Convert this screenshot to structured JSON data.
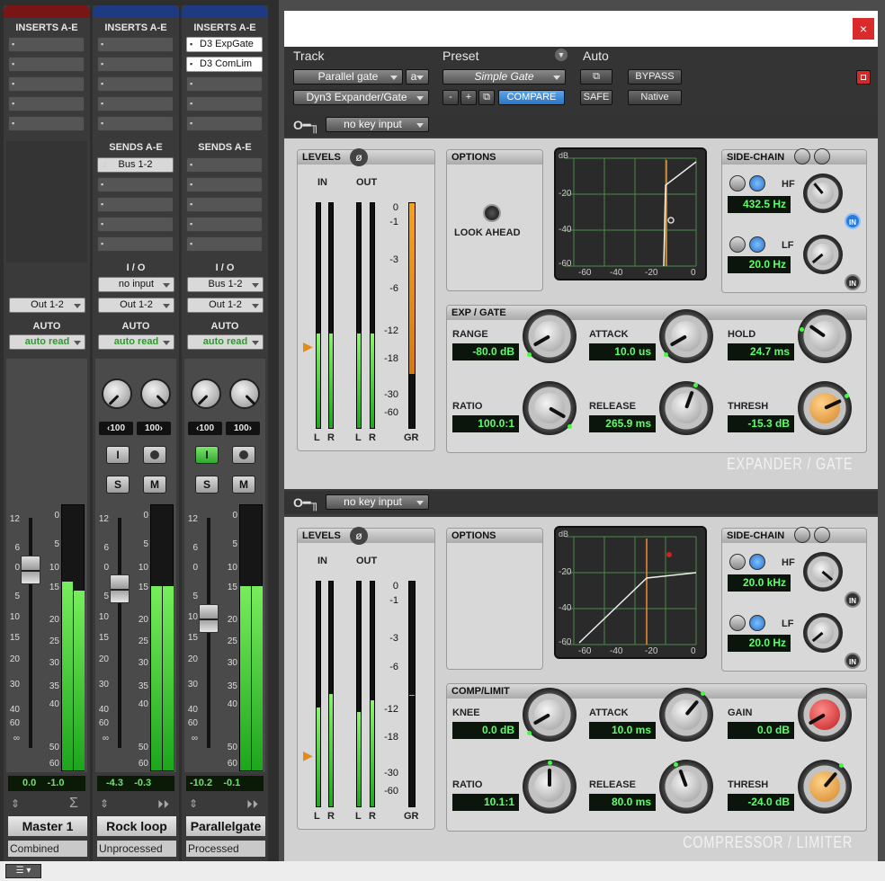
{
  "mixer": {
    "inserts_header": "INSERTS A-E",
    "sends_header": "SENDS A-E",
    "io_header": "I / O",
    "auto_header": "AUTO",
    "strips": [
      {
        "name": "Master 1",
        "comment": "Combined",
        "color": "#7a1515",
        "inserts": [],
        "sends": [],
        "io_in": "",
        "io_out": "Out 1-2",
        "auto": "auto read",
        "vol": "0.0",
        "peak": "-1.0",
        "pan_l": "",
        "pan_r": ""
      },
      {
        "name": "Rock loop",
        "comment": "Unprocessed",
        "color": "#1e3a80",
        "inserts": [],
        "sends": [
          "Bus 1-2"
        ],
        "io_in": "no input",
        "io_out": "Out 1-2",
        "auto": "auto read",
        "vol": "-4.3",
        "peak": "-0.3",
        "pan_l": "100",
        "pan_r": "100"
      },
      {
        "name": "Parallelgate",
        "comment": "Processed",
        "color": "#1e3a80",
        "inserts": [
          "D3 ExpGate",
          "D3 ComLim"
        ],
        "sends": [],
        "io_in": "Bus 1-2",
        "io_out": "Out 1-2",
        "auto": "auto read",
        "vol": "-10.2",
        "peak": "-0.1",
        "pan_l": "100",
        "pan_r": "100"
      }
    ],
    "btn_i": "I",
    "btn_s": "S",
    "btn_m": "M",
    "fader_scale": [
      "12",
      "6",
      "0",
      "5",
      "10",
      "15",
      "20",
      "30",
      "40",
      "60",
      "∞"
    ],
    "meter_scale": [
      "0",
      "5",
      "10",
      "15",
      "20",
      "25",
      "30",
      "35",
      "40",
      "50",
      "60"
    ]
  },
  "plugin": {
    "close": "×",
    "header": {
      "track_label": "Track",
      "preset_label": "Preset",
      "auto_label": "Auto",
      "track_name": "Parallel gate",
      "track_variant": "a",
      "plugin_name": "Dyn3 Expander/Gate",
      "preset_name": "Simple Gate",
      "minus": "-",
      "plus": "+",
      "compare": "COMPARE",
      "safe": "SAFE",
      "bypass": "BYPASS",
      "native": "Native"
    },
    "colors": {
      "accent_blue": "#3a8de0",
      "led_green": "#5cff6a",
      "gr_orange": "#f4a21e"
    },
    "key_input": "no key input",
    "expander": {
      "levels": "LEVELS",
      "in": "IN",
      "out": "OUT",
      "l": "L",
      "r": "R",
      "gr": "GR",
      "scale": [
        "0",
        "-1",
        "-3",
        "-6",
        "-12",
        "-18",
        "-30",
        "-60"
      ],
      "options": "OPTIONS",
      "look_ahead": "LOOK AHEAD",
      "graph_axis": [
        "-60",
        "-40",
        "-20",
        "0"
      ],
      "graph_y": [
        "dB",
        "-20",
        "-40",
        "-60"
      ],
      "sidechain": "SIDE-CHAIN",
      "hf_label": "HF",
      "hf_value": "432.5 Hz",
      "lf_label": "LF",
      "lf_value": "20.0 Hz",
      "in_btn": "IN",
      "section": "EXP / GATE",
      "range_label": "RANGE",
      "range_value": "-80.0 dB",
      "attack_label": "ATTACK",
      "attack_value": "10.0 us",
      "hold_label": "HOLD",
      "hold_value": "24.7 ms",
      "ratio_label": "RATIO",
      "ratio_value": "100.0:1",
      "release_label": "RELEASE",
      "release_value": "265.9 ms",
      "thresh_label": "THRESH",
      "thresh_value": "-15.3 dB",
      "title": "EXPANDER / GATE"
    },
    "compressor": {
      "levels": "LEVELS",
      "in": "IN",
      "out": "OUT",
      "l": "L",
      "r": "R",
      "gr": "GR",
      "scale": [
        "0",
        "-1",
        "-3",
        "-6",
        "-12",
        "-18",
        "-30",
        "-60"
      ],
      "options": "OPTIONS",
      "graph_axis": [
        "-60",
        "-40",
        "-20",
        "0"
      ],
      "graph_y": [
        "dB",
        "-20",
        "-40",
        "-60"
      ],
      "sidechain": "SIDE-CHAIN",
      "hf_label": "HF",
      "hf_value": "20.0 kHz",
      "lf_label": "LF",
      "lf_value": "20.0 Hz",
      "in_btn": "IN",
      "section": "COMP/LIMIT",
      "knee_label": "KNEE",
      "knee_value": "0.0 dB",
      "attack_label": "ATTACK",
      "attack_value": "10.0 ms",
      "gain_label": "GAIN",
      "gain_value": "0.0 dB",
      "ratio_label": "RATIO",
      "ratio_value": "10.1:1",
      "release_label": "RELEASE",
      "release_value": "80.0 ms",
      "thresh_label": "THRESH",
      "thresh_value": "-24.0 dB",
      "title": "COMPRESSOR / LIMITER"
    }
  }
}
